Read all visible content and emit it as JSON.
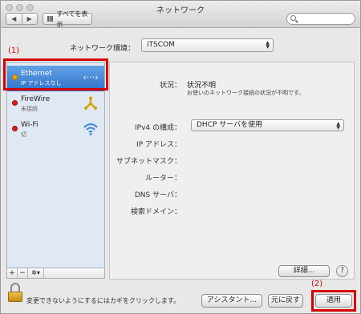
{
  "window": {
    "title": "ネットワーク"
  },
  "toolbar": {
    "back_label": "◀",
    "forward_label": "▶",
    "show_all_label": "すべてを表示"
  },
  "location": {
    "label": "ネットワーク環境：",
    "value": "iTSCOM"
  },
  "annotations": {
    "step1": "(1)",
    "step2": "(2)",
    "color": "#d40000"
  },
  "services": [
    {
      "name": "Ethernet",
      "status": "IP アドレスなし",
      "dot_color": "#f0a500",
      "icon": "ethernet-arrows-icon",
      "selected": true
    },
    {
      "name": "FireWire",
      "status": "未接続",
      "dot_color": "#d92020",
      "icon": "firewire-icon",
      "selected": false
    },
    {
      "name": "Wi-Fi",
      "status": "切",
      "dot_color": "#d92020",
      "icon": "wifi-icon",
      "selected": false
    }
  ],
  "sidebar_buttons": {
    "add": "+",
    "remove": "−",
    "action": "✲▾"
  },
  "details": {
    "status_label": "状況：",
    "status_value": "状況不明",
    "status_desc": "お使いのネットワーク接続の状況が不明です。",
    "ipv4_label": "IPv4 の構成：",
    "ipv4_value": "DHCP サーバを使用",
    "ip_label": "IP アドレス：",
    "subnet_label": "サブネットマスク：",
    "router_label": "ルーター：",
    "dns_label": "DNS サーバ：",
    "search_label": "検索ドメイン：",
    "advanced_label": "詳細...",
    "help_label": "?"
  },
  "footer": {
    "lock_text": "変更できないようにするにはカギをクリックします。",
    "assistant_label": "アシスタント...",
    "revert_label": "元に戻す",
    "apply_label": "適用"
  },
  "colors": {
    "selection": "#2f72c8",
    "wifi": "#3a86d8",
    "firewire": "#d9a400"
  }
}
